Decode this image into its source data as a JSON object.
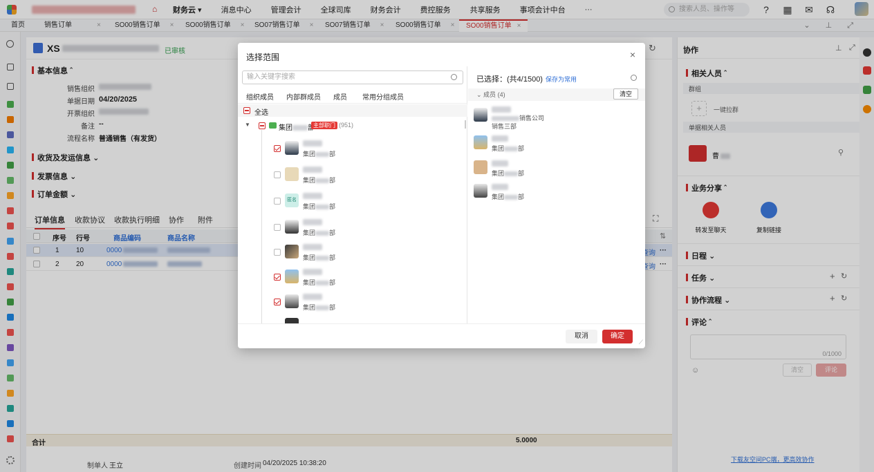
{
  "nav": {
    "items": [
      "财务云 ▾",
      "消息中心",
      "管理会计",
      "全球司库",
      "财务会计",
      "费控服务",
      "共享服务",
      "事项会计中台",
      "···"
    ],
    "search_placeholder": "搜索人员、操作等"
  },
  "tabs": [
    {
      "label": "首页",
      "active": false
    },
    {
      "label": "销售订单",
      "active": false
    },
    {
      "label": "SO00销售订单",
      "active": false
    },
    {
      "label": "SO00销售订单",
      "active": false
    },
    {
      "label": "SO07销售订单",
      "active": false
    },
    {
      "label": "SO07销售订单",
      "active": false
    },
    {
      "label": "SO00销售订单",
      "active": false
    },
    {
      "label": "SO00销售订单",
      "active": true
    }
  ],
  "doc": {
    "title": "XS",
    "status": "已审核",
    "sections": {
      "basic": "基本信息",
      "shipping": "收货及发运信息",
      "invoice": "发票信息",
      "amount": "订单金额"
    },
    "fields": [
      {
        "k": "销售组织",
        "v": ""
      },
      {
        "k": "单据日期",
        "v": "04/20/2025"
      },
      {
        "k": "开票组织",
        "v": ""
      },
      {
        "k": "备注",
        "v": "--"
      },
      {
        "k": "流程名称",
        "v": "普通销售（有发货）"
      }
    ]
  },
  "grid": {
    "tabs": [
      "订单信息",
      "收款协议",
      "收款执行明细",
      "协作",
      "附件"
    ],
    "headers": [
      "序号",
      "行号",
      "商品编码",
      "商品名称"
    ],
    "rows": [
      {
        "seq": "1",
        "line": "10",
        "code": "0000",
        "op": "查询"
      },
      {
        "seq": "2",
        "line": "20",
        "code": "0000",
        "op": "查询"
      }
    ],
    "sum_label": "合计",
    "sum_value": "5.0000"
  },
  "footer": {
    "creator_label": "制单人",
    "creator": "王立",
    "created_label": "创建时间",
    "created": "04/20/2025 10:38:20"
  },
  "right_panel": {
    "title": "协作",
    "related": "相关人员",
    "group": "群组",
    "one_click_group": "一键拉群",
    "doc_related": "单据相关人员",
    "person": "曹",
    "share": "业务分享",
    "share_chat": "转发至聊天",
    "copy_link": "复制链接",
    "schedule": "日程",
    "task": "任务",
    "flow": "协作流程",
    "comment": "评论",
    "comment_count": "0/1000",
    "clear_btn": "清空",
    "comment_btn": "评论",
    "download": "下载友空间PC端，更高效协作"
  },
  "modal": {
    "title": "选择范围",
    "search_placeholder": "输入关键字搜索",
    "tabs": [
      "组织成员",
      "内部群成员",
      "成员",
      "常用分组成员"
    ],
    "select_all": "全选",
    "dept_prefix": "集团",
    "dept_suffix": "部",
    "dept_tag": "主部职门",
    "dept_count": "(951)",
    "member_dept_prefix": "集团",
    "member_dept_suffix": "部",
    "placeholder_avatar": "匿名",
    "selected_label": "已选择：(共4",
    "selected_limit": "/1500)",
    "save_common": "保存为常用",
    "group_label": "成员",
    "group_count": "(4)",
    "clear": "清空",
    "sel_company_suffix": "销售公司",
    "sel_dept": "销售三部",
    "cancel": "取消",
    "ok": "确定"
  }
}
